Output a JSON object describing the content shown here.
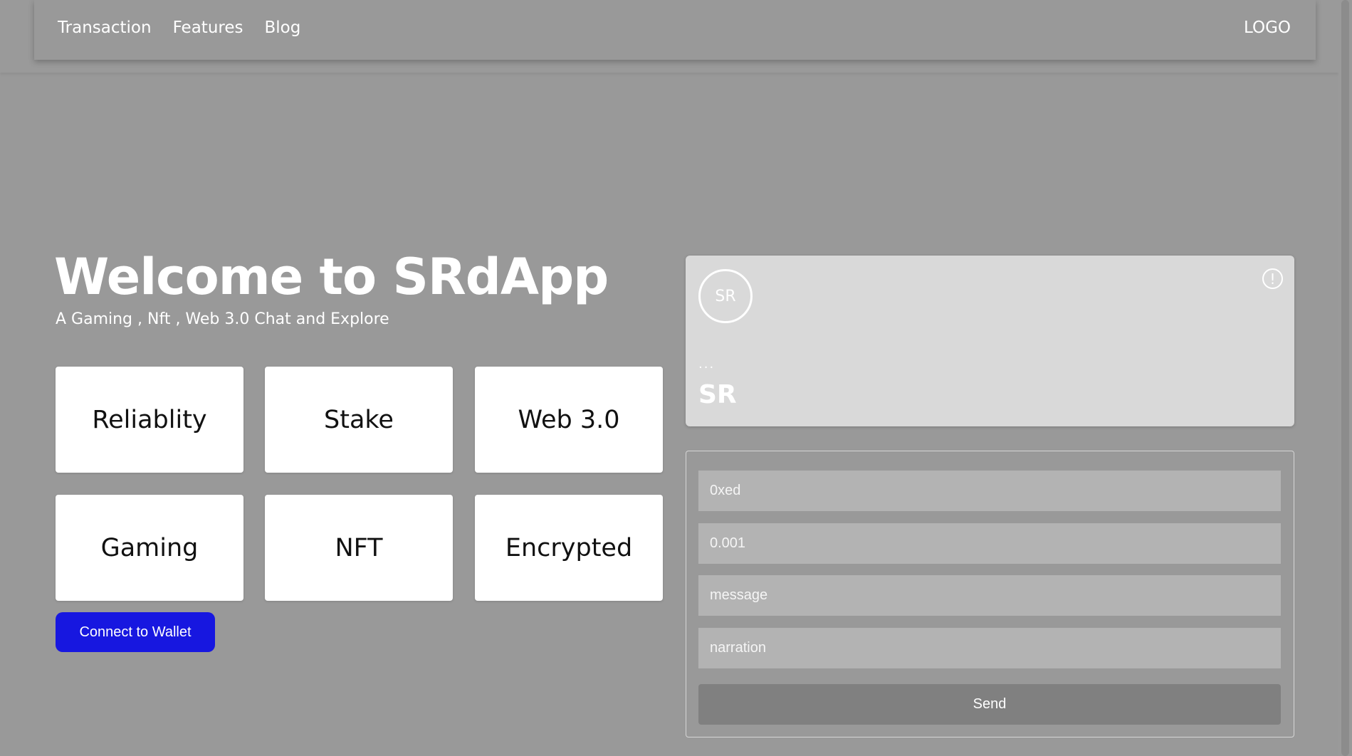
{
  "nav": {
    "links": [
      "Transaction",
      "Features",
      "Blog"
    ],
    "logo": "LOGO"
  },
  "hero": {
    "title": "Welcome to SRdApp",
    "subtitle": "A Gaming , Nft , Web 3.0 Chat and Explore"
  },
  "features": [
    "Reliablity",
    "Stake",
    "Web 3.0",
    "Gaming",
    "NFT",
    "Encrypted"
  ],
  "connect_button": "Connect to Wallet",
  "wallet_card": {
    "avatar_text": "SR",
    "info_icon": "!",
    "address": "...",
    "name": "SR"
  },
  "form": {
    "address_placeholder": "0xed",
    "amount_placeholder": "0.001",
    "message_placeholder": "message",
    "narration_placeholder": "narration",
    "send_label": "Send"
  },
  "colors": {
    "background": "#999999",
    "card_background": "#ffffff",
    "wallet_card_background": "#d9d9d9",
    "primary_button": "#1717e0",
    "send_button": "#808080",
    "input_background": "#b3b3b3"
  }
}
